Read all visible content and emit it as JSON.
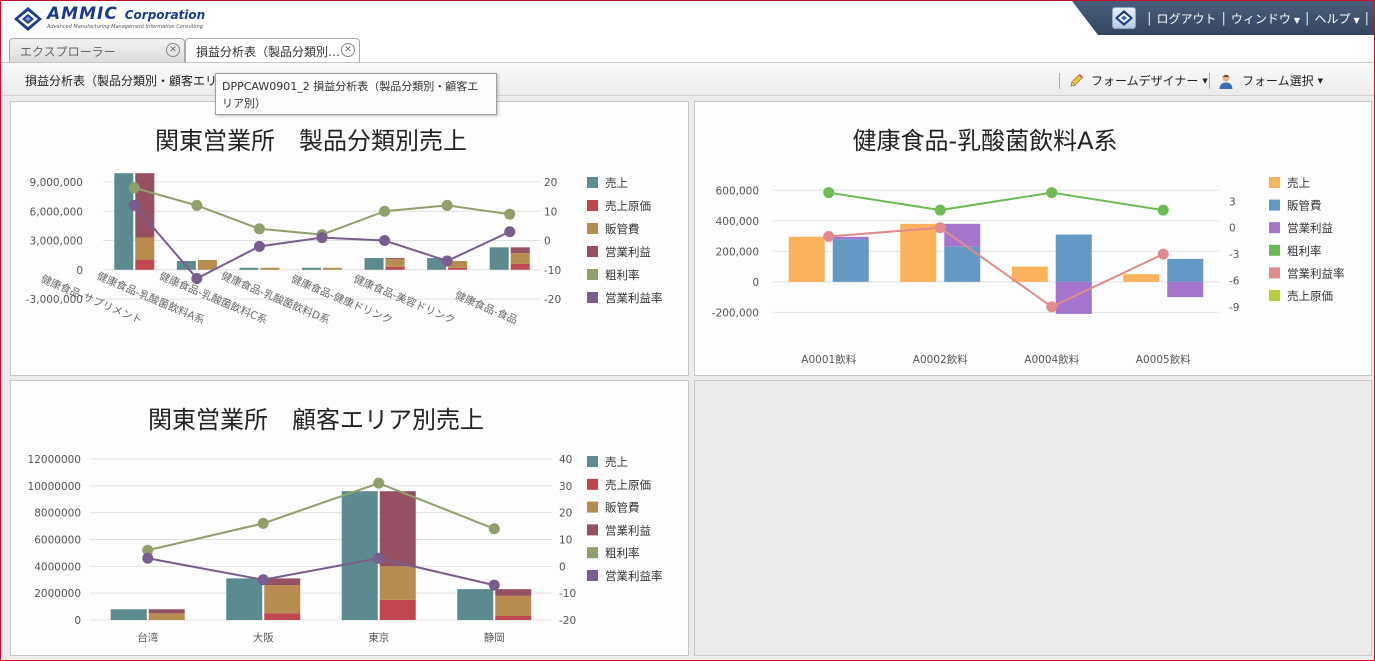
{
  "header": {
    "brand": "AMMIC",
    "brand_suffix": "Corporation",
    "tagline": "Advanced Manufacturing Management Information Consulting",
    "menu": [
      {
        "label": "ログアウト",
        "dropdown": false
      },
      {
        "label": "ウィンドウ",
        "dropdown": true
      },
      {
        "label": "ヘルプ",
        "dropdown": true
      }
    ]
  },
  "tabs": [
    {
      "label": "エクスプローラー",
      "active": false
    },
    {
      "label": "損益分析表（製品分類別…",
      "active": true
    }
  ],
  "toolbar": {
    "breadcrumb": "損益分析表（製品分類別・顧客エリア",
    "form_designer": "フォームデザイナー",
    "form_select": "フォーム選択"
  },
  "tooltip": {
    "line1": "DPPCAW0901_2 損益分析表（製品分類別・顧客エ",
    "line2": "リア別）"
  },
  "colors": {
    "accent": "#34465f",
    "sales": "#5b8a8f",
    "cost": "#c0464f",
    "sga": "#b78c4f",
    "op_profit": "#955061",
    "gross_rate": "#8fa06a",
    "op_rate": "#7a5c8e",
    "b_sales": "#fbb25c",
    "b_sga": "#6499c5",
    "b_op": "#a574cc",
    "b_gross": "#6dbb55",
    "b_oprate": "#e08c8c",
    "b_cost": "#b5d13a"
  },
  "chart_data": [
    {
      "type": "bar",
      "title": "関東営業所　製品分類別売上",
      "categories": [
        "健康食品-サプリメント",
        "健康食品-乳酸菌飲料A系",
        "健康食品-乳酸菌飲料C系",
        "健康食品-乳酸菌飲料D系",
        "健康食品-健康ドリンク",
        "健康食品-美容ドリンク",
        "健康食品-食品"
      ],
      "series": [
        {
          "name": "売上",
          "axis": "left",
          "group": "a",
          "values": [
            9900000,
            900000,
            200000,
            200000,
            1200000,
            1200000,
            2300000
          ]
        },
        {
          "name": "売上原価",
          "axis": "left",
          "group": "b",
          "values": [
            1000000,
            0,
            0,
            0,
            300000,
            200000,
            600000
          ]
        },
        {
          "name": "販管費",
          "axis": "left",
          "group": "b",
          "values": [
            2300000,
            1000000,
            200000,
            200000,
            800000,
            700000,
            1100000
          ]
        },
        {
          "name": "営業利益",
          "axis": "left",
          "group": "b",
          "values": [
            6600000,
            0,
            0,
            0,
            100000,
            0,
            600000
          ]
        },
        {
          "name": "粗利率",
          "axis": "right",
          "type": "line",
          "values": [
            18,
            12,
            4,
            2,
            10,
            12,
            9
          ]
        },
        {
          "name": "営業利益率",
          "axis": "right",
          "type": "line",
          "values": [
            12,
            -13,
            -2,
            1,
            0,
            -7,
            3
          ]
        }
      ],
      "yticks_left": [
        "9,000,000",
        "6,000,000",
        "3,000,000",
        "0",
        "-3,000,000"
      ],
      "ylim_left": [
        -3000000,
        9000000
      ],
      "yticks_right": [
        "20",
        "10",
        "0",
        "-10",
        "-20"
      ],
      "ylim_right": [
        -20,
        20
      ],
      "legend": "right"
    },
    {
      "type": "bar",
      "title": "健康食品-乳酸菌飲料A系",
      "categories": [
        "A0001飲料",
        "A0002飲料",
        "A0004飲料",
        "A0005飲料"
      ],
      "series": [
        {
          "name": "売上",
          "axis": "left",
          "group": "a",
          "values": [
            295000,
            380000,
            100000,
            50000
          ]
        },
        {
          "name": "販管費",
          "axis": "left",
          "group": "b",
          "values": [
            280000,
            230000,
            310000,
            150000
          ]
        },
        {
          "name": "営業利益",
          "axis": "left",
          "group": "b",
          "values": [
            15000,
            150000,
            -210000,
            -100000
          ]
        },
        {
          "name": "粗利率",
          "axis": "right",
          "type": "line",
          "values": [
            4,
            2,
            4,
            2
          ]
        },
        {
          "name": "営業利益率",
          "axis": "right",
          "type": "line",
          "values": [
            -1,
            0,
            -9,
            -3
          ]
        },
        {
          "name": "売上原価",
          "axis": "left",
          "group": "b",
          "values": [
            0,
            0,
            0,
            0
          ]
        }
      ],
      "yticks_left": [
        "600,000",
        "400,000",
        "200,000",
        "0",
        "-200,000"
      ],
      "ylim_left": [
        -250000,
        700000
      ],
      "yticks_right": [
        "3",
        "0",
        "-3",
        "-6",
        "-9"
      ],
      "ylim_right": [
        -10.5,
        6
      ],
      "legend": "right"
    },
    {
      "type": "bar",
      "title": "関東営業所　顧客エリア別売上",
      "categories": [
        "台湾",
        "大阪",
        "東京",
        "静岡"
      ],
      "series": [
        {
          "name": "売上",
          "axis": "left",
          "group": "a",
          "values": [
            800000,
            3100000,
            9600000,
            2300000
          ]
        },
        {
          "name": "売上原価",
          "axis": "left",
          "group": "b",
          "values": [
            0,
            500000,
            1500000,
            300000
          ]
        },
        {
          "name": "販管費",
          "axis": "left",
          "group": "b",
          "values": [
            500000,
            2100000,
            2500000,
            1500000
          ]
        },
        {
          "name": "営業利益",
          "axis": "left",
          "group": "b",
          "values": [
            300000,
            500000,
            5600000,
            500000
          ]
        },
        {
          "name": "粗利率",
          "axis": "right",
          "type": "line",
          "values": [
            6,
            16,
            31,
            14
          ]
        },
        {
          "name": "営業利益率",
          "axis": "right",
          "type": "line",
          "values": [
            3,
            -5,
            3,
            -7
          ]
        }
      ],
      "yticks_left": [
        "12000000",
        "10000000",
        "8000000",
        "6000000",
        "4000000",
        "2000000",
        "0"
      ],
      "ylim_left": [
        0,
        12000000
      ],
      "yticks_right": [
        "40",
        "30",
        "20",
        "10",
        "0",
        "-10",
        "-20"
      ],
      "ylim_right": [
        -20,
        40
      ],
      "legend": "right"
    }
  ]
}
